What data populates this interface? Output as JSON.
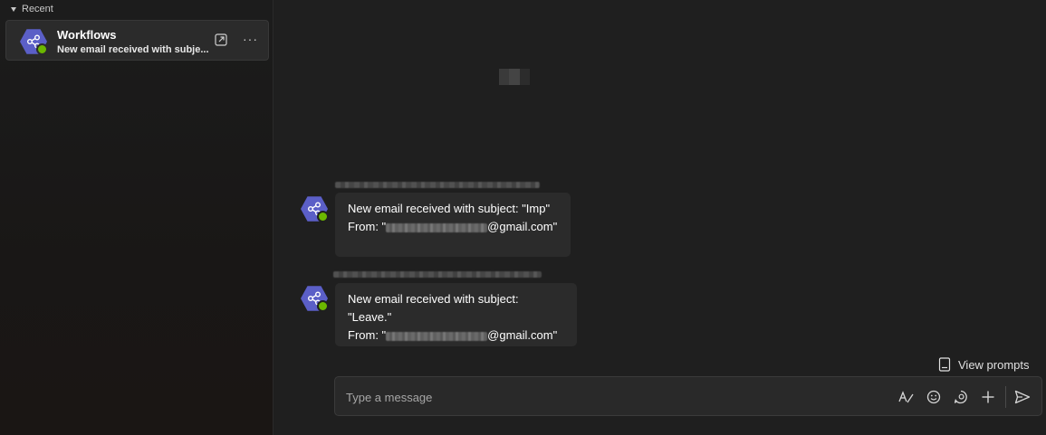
{
  "sidebar": {
    "section_label": "Recent",
    "chats": [
      {
        "title": "Workflows",
        "subtitle": "New email received with subje...",
        "icon": "workflows-share-icon",
        "status": "available"
      }
    ]
  },
  "messages": [
    {
      "line1": "New email received with subject: \"Imp\"",
      "from_prefix": "From: \"",
      "from_suffix": "@gmail.com\""
    },
    {
      "line1": "New email received with subject: \"Leave.\"",
      "from_prefix": "From: \"",
      "from_suffix": "@gmail.com\""
    }
  ],
  "composer": {
    "placeholder": "Type a message",
    "view_prompts_label": "View prompts",
    "tools": [
      "format-icon",
      "emoji-icon",
      "loop-icon",
      "plus-icon",
      "send-icon"
    ]
  },
  "colors": {
    "accent": "#5b5fc7",
    "status_green": "#6bb700",
    "background": "#1f1f1f",
    "bubble": "#2b2b2b"
  }
}
